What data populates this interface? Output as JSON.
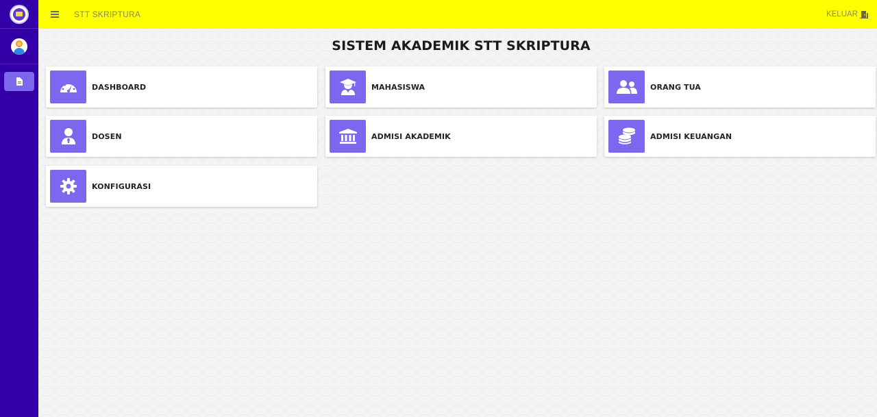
{
  "header": {
    "app_title": "STT SKRIPTURA",
    "logout_label": "KELUAR"
  },
  "sidebar": {
    "items": [
      {
        "icon": "document-icon"
      }
    ]
  },
  "main": {
    "title": "SISTEM AKADEMIK STT SKRIPTURA",
    "cards": [
      {
        "label": "DASHBOARD",
        "icon": "speedometer-icon"
      },
      {
        "label": "MAHASISWA",
        "icon": "graduate-icon"
      },
      {
        "label": "ORANG TUA",
        "icon": "users-icon"
      },
      {
        "label": "DOSEN",
        "icon": "user-tie-icon"
      },
      {
        "label": "ADMISI AKADEMIK",
        "icon": "university-icon"
      },
      {
        "label": "ADMISI KEUANGAN",
        "icon": "coins-icon"
      },
      {
        "label": "KONFIGURASI",
        "icon": "gear-icon"
      }
    ]
  },
  "colors": {
    "sidebar": "#3300a8",
    "topbar": "#ffff00",
    "accent": "#7b68ee"
  }
}
